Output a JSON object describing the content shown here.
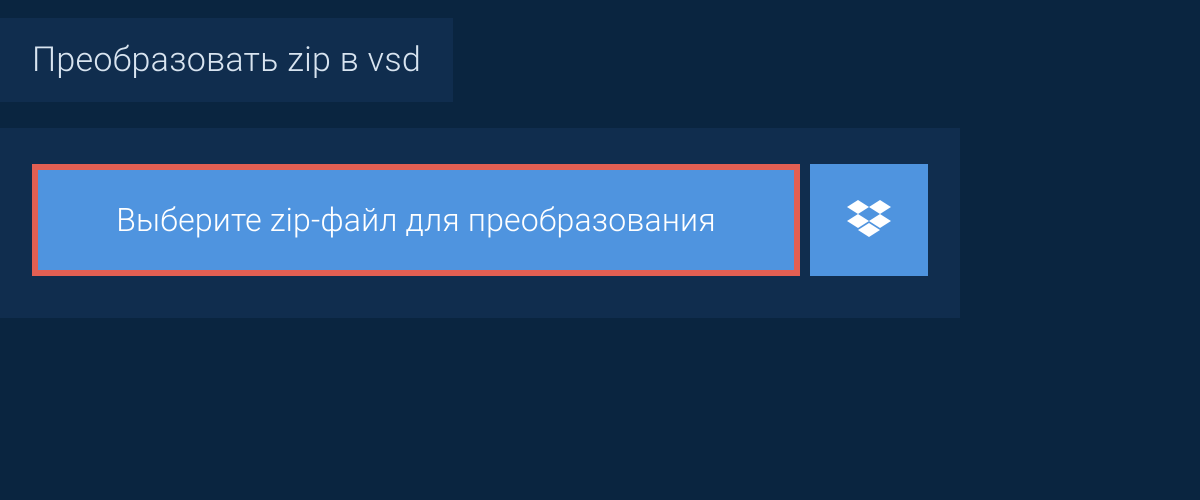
{
  "header": {
    "title": "Преобразовать zip в vsd"
  },
  "upload": {
    "select_label": "Выберите zip-файл для преобразования"
  }
}
